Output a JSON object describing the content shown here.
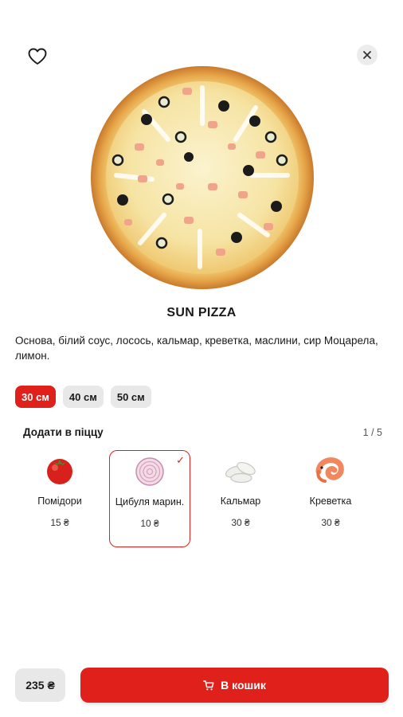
{
  "header": {
    "favorite_icon": "heart-outline-icon",
    "close_icon": "close-icon"
  },
  "product": {
    "image": "pizza-photo",
    "name": "SUN PIZZA",
    "description": "Основа, білий соус, лосось, кальмар, креветка, маслини, сир Моцарела, лимон."
  },
  "sizes": [
    {
      "label": "30 см",
      "selected": true
    },
    {
      "label": "40 см",
      "selected": false
    },
    {
      "label": "50 см",
      "selected": false
    }
  ],
  "addons": {
    "title": "Додати в піццу",
    "page_indicator": "1 / 5",
    "items": [
      {
        "name": "Помідори",
        "price": "15 ₴",
        "icon": "tomato-icon",
        "selected": false
      },
      {
        "name": "Цибуля марин.",
        "price": "10 ₴",
        "icon": "onion-icon",
        "selected": true
      },
      {
        "name": "Кальмар",
        "price": "30 ₴",
        "icon": "squid-icon",
        "selected": false
      },
      {
        "name": "Креветка",
        "price": "30 ₴",
        "icon": "shrimp-icon",
        "selected": false
      }
    ],
    "check_mark": "✓"
  },
  "footer": {
    "total": "235 ₴",
    "cart_label": "В кошик",
    "cart_icon": "cart-icon"
  },
  "colors": {
    "accent": "#e0211b",
    "chip_bg": "#e8e8e8"
  }
}
